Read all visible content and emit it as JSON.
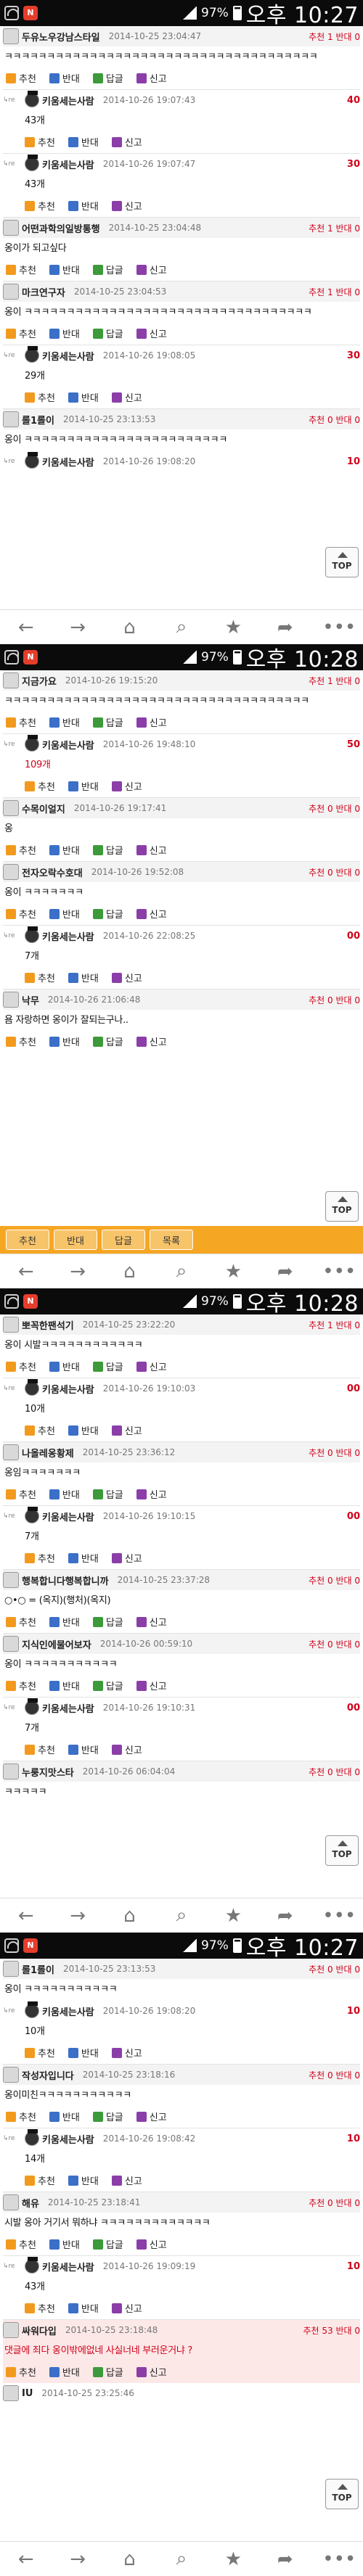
{
  "status": {
    "screens": [
      {
        "battery": "97%",
        "time": "오후 10:27"
      },
      {
        "battery": "97%",
        "time": "오후 10:28"
      },
      {
        "battery": "97%",
        "time": "오후 10:28"
      },
      {
        "battery": "97%",
        "time": "오후 10:27"
      }
    ]
  },
  "labels": {
    "recommend": "추천",
    "oppose": "반대",
    "reply": "답글",
    "report": "신고",
    "top": "TOP",
    "reply_indicator": "↳re"
  },
  "screen1": [
    {
      "nick": "두유노우강남스타일",
      "time": "2014-10-25 23:04:47",
      "score": "추천 1 반대 0",
      "text": "ㅋㅋㅋㅋㅋㅋㅋㅋㅋㅋㅋㅋㅋㅋㅋㅋㅋㅋㅋㅋㅋㅋㅋㅋㅋㅋㅋㅋㅋㅋㅋㅋㅋㅋㅋㅋㅋ"
    },
    {
      "nick": "키움세는사람",
      "time": "2014-10-26 19:07:43",
      "num": "40",
      "text": "43개"
    },
    {
      "nick": "키움세는사람",
      "time": "2014-10-26 19:07:47",
      "num": "30",
      "text": "43개"
    },
    {
      "nick": "어떤과학의일방통행",
      "time": "2014-10-25 23:04:48",
      "score": "추천 1 반대 0",
      "text": "옹이가 되고싶다"
    },
    {
      "nick": "마크연구자",
      "time": "2014-10-25 23:04:53",
      "score": "추천 1 반대 0",
      "text": "옹이 ㅋㅋㅋㅋㅋㅋㅋㅋㅋㅋㅋㅋㅋㅋㅋㅋㅋㅋㅋㅋㅋㅋㅋㅋㅋㅋㅋㅋㅋㅋㅋㅋㅋㅋ"
    },
    {
      "nick": "키움세는사람",
      "time": "2014-10-26 19:08:05",
      "num": "30",
      "text": "29개"
    },
    {
      "nick": "롤1롤이",
      "time": "2014-10-25 23:13:53",
      "score": "추천 0 반대 0",
      "text": "옹이 ㅋㅋㅋㅋㅋㅋㅋㅋㅋㅋㅋㅋㅋㅋㅋㅋㅋㅋㅋㅋㅋㅋㅋㅋ"
    },
    {
      "nick": "키움세는사람",
      "time": "2014-10-26 19:08:20",
      "num": "10",
      "text": ""
    }
  ],
  "screen2": [
    {
      "nick": "지금가요",
      "time": "2014-10-26 19:15:20",
      "score": "추천 1 반대 0",
      "text": "ㅋㅋㅋㅋㅋㅋㅋㅋㅋㅋㅋㅋㅋㅋㅋㅋㅋㅋㅋㅋㅋㅋㅋㅋㅋㅋㅋㅋㅋㅋㅋㅋㅋㅋㅋㅋ"
    },
    {
      "nick": "키움세는사람",
      "time": "2014-10-26 19:48:10",
      "num": "50",
      "text": "109개"
    },
    {
      "nick": "수목이얼지",
      "time": "2014-10-26 19:17:41",
      "score": "추천 0 반대 0",
      "text": "옹"
    },
    {
      "nick": "전자오락수호대",
      "time": "2014-10-26 19:52:08",
      "score": "추천 0 반대 0",
      "text": "옹이 ㅋㅋㅋㅋㅋㅋㅋ"
    },
    {
      "nick": "키움세는사람",
      "time": "2014-10-26 22:08:25",
      "num": "00",
      "text": "7개"
    },
    {
      "nick": "낙무",
      "time": "2014-10-26 21:06:48",
      "score": "추천 0 반대 0",
      "text": "욤 자랑하면 옹이가 잘되는구나.."
    }
  ],
  "screen2_bar": {
    "b1": "추천",
    "b2": "반대",
    "b3": "답글",
    "b4": "목록"
  },
  "screen3": [
    {
      "nick": "뽀꼭한팬석기",
      "time": "2014-10-25 23:22:20",
      "score": "추천 1 반대 0",
      "text": "옹이 시발ㅋㅋㅋㅋㅋㅋㅋㅋㅋㅋㅋㅋ"
    },
    {
      "nick": "키움세는사람",
      "time": "2014-10-26 19:10:03",
      "num": "00",
      "text": "10개"
    },
    {
      "nick": "나올레옹황제",
      "time": "2014-10-25 23:36:12",
      "score": "추천 0 반대 0",
      "text": "옹임ㅋㅋㅋㅋㅋㅋㅋ"
    },
    {
      "nick": "키움세는사람",
      "time": "2014-10-26 19:10:15",
      "num": "00",
      "text": "7개"
    },
    {
      "nick": "행복합니다행복합니까",
      "time": "2014-10-25 23:37:28",
      "score": "추천 0 반대 0",
      "text": "○•○ = (옥지)(행처)(옥지)"
    },
    {
      "nick": "지식인에물어보자",
      "time": "2014-10-26 00:59:10",
      "score": "추천 0 반대 0",
      "text": "옹이 ㅋㅋㅋㅋㅋㅋㅋㅋㅋㅋㅋ"
    },
    {
      "nick": "키움세는사람",
      "time": "2014-10-26 19:10:31",
      "num": "00",
      "text": "7개"
    },
    {
      "nick": "누룽지맛스타",
      "time": "2014-10-26 06:04:04",
      "score": "추천 0 반대 0",
      "text": "ㅋㅋㅋㅋㅋ"
    }
  ],
  "screen4": [
    {
      "nick": "롤1롤이",
      "time": "2014-10-25 23:13:53",
      "score": "추천 0 반대 0",
      "text": "옹이 ㅋㅋㅋㅋㅋㅋㅋㅋㅋㅋㅋ"
    },
    {
      "nick": "키움세는사람",
      "time": "2014-10-26 19:08:20",
      "num": "10",
      "text": "10개"
    },
    {
      "nick": "작성자입니다",
      "time": "2014-10-25 23:18:16",
      "score": "추천 0 반대 0",
      "text": "옹이미친ㅋㅋㅋㅋㅋㅋㅋㅋㅋㅋㅋ"
    },
    {
      "nick": "키움세는사람",
      "time": "2014-10-26 19:08:42",
      "num": "10",
      "text": "14개"
    },
    {
      "nick": "해유",
      "time": "2014-10-25 23:18:41",
      "score": "추천 0 반대 0",
      "text": "시발 옹아 거기서 뭐하냐 ㅋㅋㅋㅋㅋㅋㅋㅋㅋㅋㅋㅋㅋ"
    },
    {
      "nick": "키움세는사람",
      "time": "2014-10-26 19:09:19",
      "num": "10",
      "text": "43개"
    },
    {
      "nick": "싸워다입",
      "time": "2014-10-25 23:18:48",
      "score": "추천 53 반대 0",
      "text": "댓글에 죄다 옹이밖에없네 사실너네 부러운거냐 ?"
    },
    {
      "nick": "IU",
      "time": "2014-10-25 23:25:46",
      "score": "",
      "text": ""
    }
  ]
}
